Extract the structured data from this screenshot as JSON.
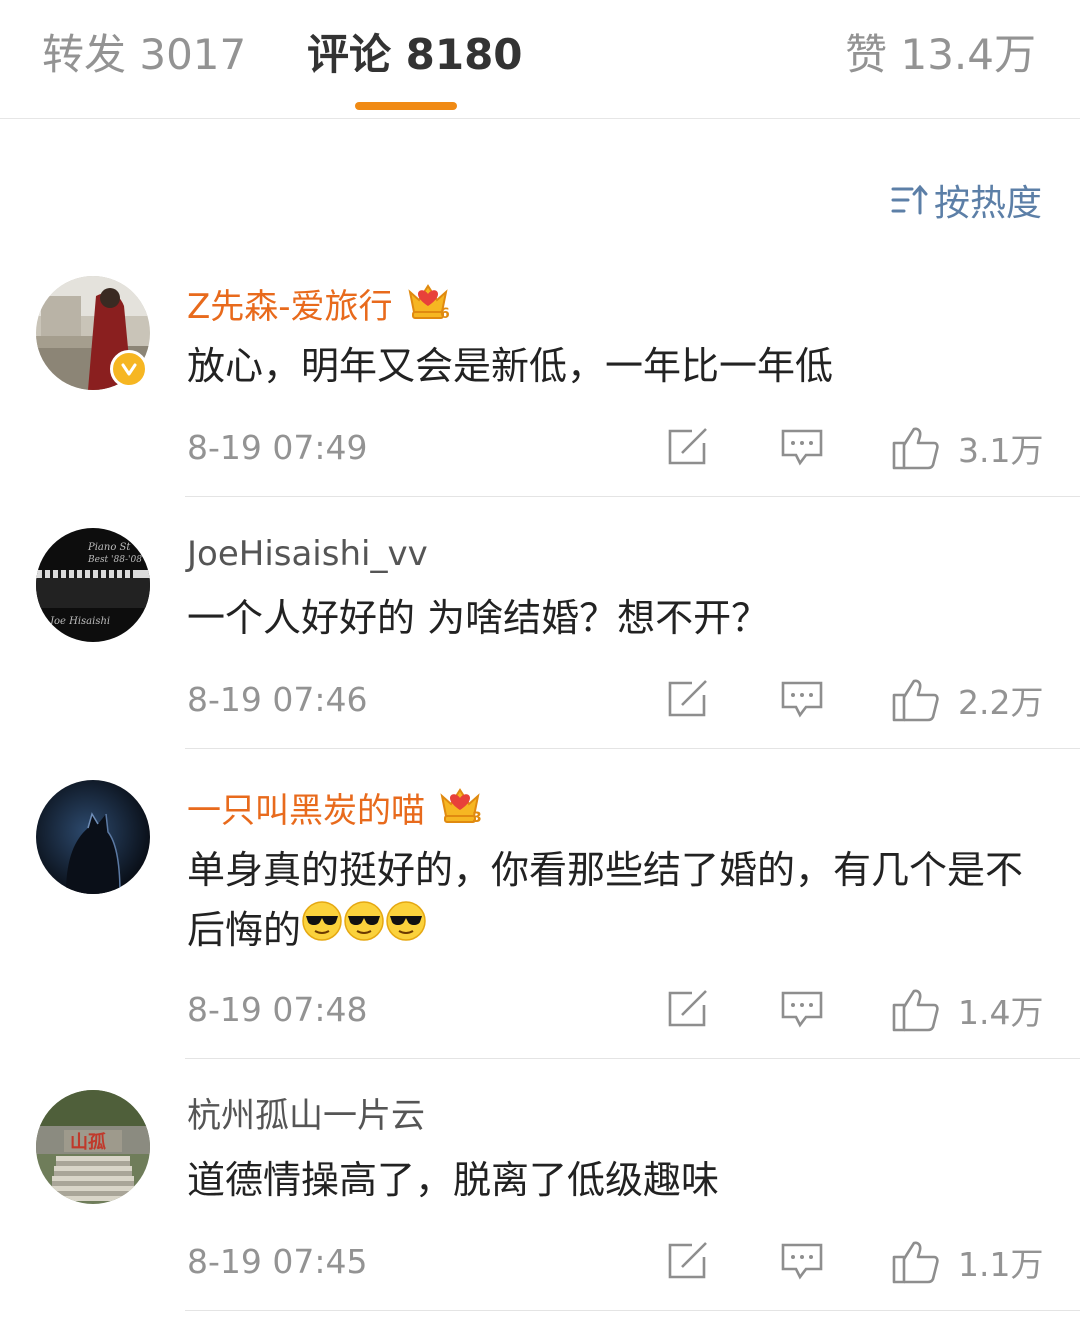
{
  "tabs": {
    "forward_label": "转发 3017",
    "comment_label": "评论 8180",
    "like_label": "赞 13.4万",
    "active_color": "#f08a14"
  },
  "sort": {
    "label": "按热度",
    "icon": "sort-icon"
  },
  "comments": [
    {
      "username": "Z先森-爱旅行",
      "vip": true,
      "verified": true,
      "text": "放心，明年又会是新低，一年比一年低",
      "time": "8-19 07:49",
      "likes": "3.1万"
    },
    {
      "username": "JoeHisaishi_vv",
      "vip": false,
      "verified": false,
      "avatar_text": "Piano St Best '88-'08 Joe Hisaishi",
      "text": "一个人好好的 为啥结婚？想不开？",
      "time": "8-19 07:46",
      "likes": "2.2万"
    },
    {
      "username": "一只叫黑炭的喵",
      "vip": true,
      "verified": false,
      "text": "单身真的挺好的，你看那些结了婚的，有几个是不后悔的",
      "text_emoji": "sunglasses-emoji x3",
      "time": "8-19 07:48",
      "likes": "1.4万"
    },
    {
      "username": "杭州孤山一片云",
      "vip": false,
      "verified": false,
      "avatar_text": "山孤",
      "text": "道德情操高了，脱离了低级趣味",
      "time": "8-19 07:45",
      "likes": "1.1万"
    }
  ],
  "colors": {
    "vip_name": "#e86a1c",
    "link_blue": "#5c7fa7",
    "meta_gray": "#939393"
  }
}
